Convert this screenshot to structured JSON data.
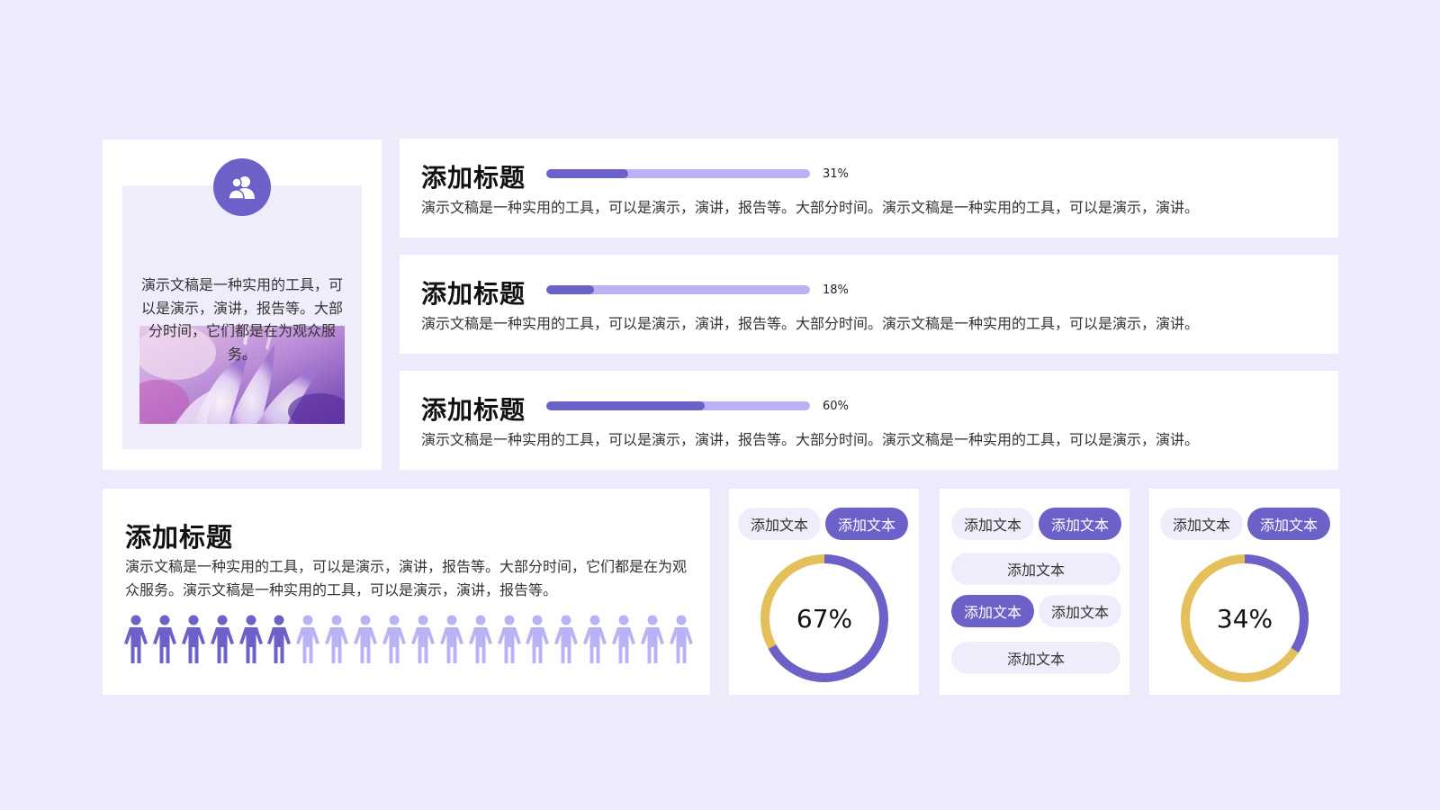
{
  "colors": {
    "background": "#ECEBFB",
    "accent": "#6B61C8",
    "accent_light": "#B9B3F5",
    "donut_track": "#E5BF5A",
    "pill_light": "#EFEDFC"
  },
  "profile": {
    "icon": "users-icon",
    "text": "演示文稿是一种实用的工具，可以是演示，演讲，报告等。大部分时间，它们都是在为观众服务。"
  },
  "rows": [
    {
      "title": "添加标题",
      "progress": 0.31,
      "progress_label": "31%",
      "desc": "演示文稿是一种实用的工具，可以是演示，演讲，报告等。大部分时间。演示文稿是一种实用的工具，可以是演示，演讲。"
    },
    {
      "title": "添加标题",
      "progress": 0.18,
      "progress_label": "18%",
      "desc": "演示文稿是一种实用的工具，可以是演示，演讲，报告等。大部分时间。演示文稿是一种实用的工具，可以是演示，演讲。"
    },
    {
      "title": "添加标题",
      "progress": 0.6,
      "progress_label": "60%",
      "desc": "演示文稿是一种实用的工具，可以是演示，演讲，报告等。大部分时间。演示文稿是一种实用的工具，可以是演示，演讲。"
    }
  ],
  "people": {
    "title": "添加标题",
    "desc": "演示文稿是一种实用的工具，可以是演示，演讲，报告等。大部分时间，它们都是在为观众服务。演示文稿是一种实用的工具，可以是演示，演讲，报告等。",
    "total": 20,
    "highlighted": 6
  },
  "donut1": {
    "pill_left": "添加文本",
    "pill_right": "添加文本",
    "value": 0.67,
    "label": "67%"
  },
  "buttons": {
    "top_left": "添加文本",
    "top_right": "添加文本",
    "wide_1": "添加文本",
    "mid_left": "添加文本",
    "mid_right": "添加文本",
    "wide_2": "添加文本"
  },
  "donut2": {
    "pill_left": "添加文本",
    "pill_right": "添加文本",
    "value": 0.34,
    "label": "34%"
  }
}
